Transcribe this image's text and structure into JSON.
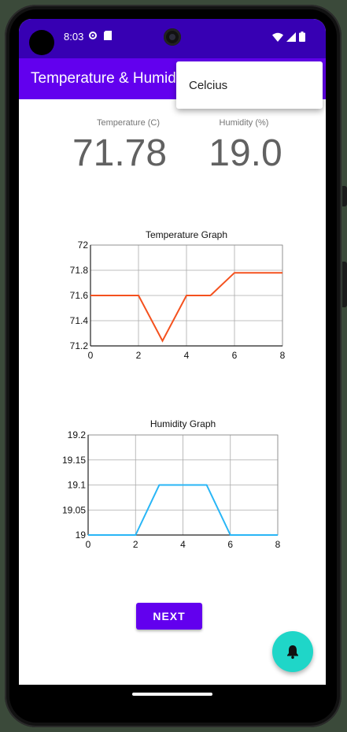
{
  "status_bar": {
    "time": "8:03",
    "icons_left": [
      "settings-icon",
      "sd-card-icon"
    ],
    "icons_right": [
      "wifi-icon",
      "signal-icon",
      "battery-icon"
    ]
  },
  "app_bar": {
    "title": "Temperature & Humidity",
    "color": "#6200ee"
  },
  "overflow_menu": {
    "items": [
      {
        "label": "Celcius"
      }
    ]
  },
  "readings": {
    "temperature": {
      "label": "Temperature (C)",
      "value": "71.78"
    },
    "humidity": {
      "label": "Humidity (%)",
      "value": "19.0"
    }
  },
  "next_button": {
    "label": "NEXT"
  },
  "fab": {
    "icon": "bell-icon",
    "color": "#1fd6c8"
  },
  "chart_data": [
    {
      "type": "line",
      "title": "Temperature Graph",
      "x": [
        0,
        1,
        2,
        3,
        4,
        5,
        6,
        7,
        8
      ],
      "series": [
        {
          "values": [
            71.6,
            71.6,
            71.6,
            71.24,
            71.6,
            71.6,
            71.78,
            71.78,
            71.78
          ],
          "color": "#f4511e"
        }
      ],
      "xlim": [
        0,
        8
      ],
      "ylim": [
        71.2,
        72
      ],
      "xticks": [
        0,
        2,
        4,
        6,
        8
      ],
      "yticks": [
        71.2,
        71.4,
        71.6,
        71.8,
        72
      ],
      "grid": true
    },
    {
      "type": "line",
      "title": "Humidity Graph",
      "x": [
        0,
        1,
        2,
        3,
        4,
        5,
        6,
        7,
        8
      ],
      "series": [
        {
          "values": [
            19,
            19,
            19,
            19.1,
            19.1,
            19.1,
            19,
            19,
            19
          ],
          "color": "#29b6f6"
        }
      ],
      "xlim": [
        0,
        8
      ],
      "ylim": [
        19,
        19.2
      ],
      "xticks": [
        0,
        2,
        4,
        6,
        8
      ],
      "yticks": [
        19,
        19.05,
        19.1,
        19.15,
        19.2
      ],
      "grid": true
    }
  ]
}
